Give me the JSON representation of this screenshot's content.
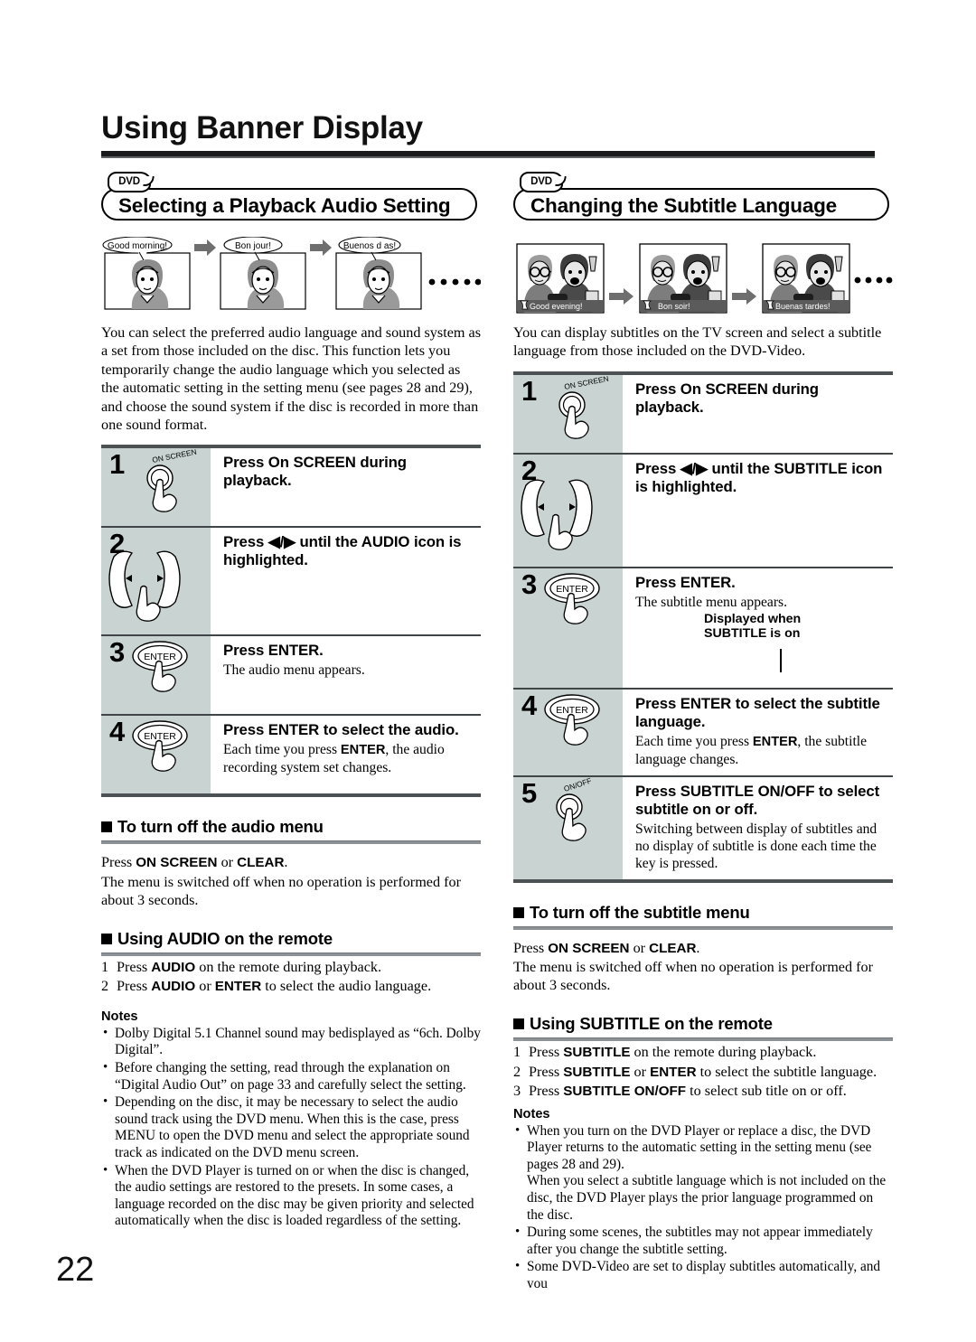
{
  "page": {
    "title": "Using Banner Display",
    "number": "22"
  },
  "left": {
    "badge": "DVD",
    "section_title": "Selecting a Playback Audio Setting",
    "illustration": {
      "bubbles": [
        "Good morning!",
        "Bon jour!",
        "Buenos d as!"
      ],
      "ellipsis": "• • • • •"
    },
    "intro": "You can select the preferred audio language and sound system as a set from those included on the disc. This function lets you temporarily change the audio language which you selected as the automatic setting in the setting menu (see pages 28 and 29), and choose the sound system if the disc is recorded in more than one sound format.",
    "steps": [
      {
        "num": "1",
        "icon": "on-screen-button",
        "icon_label": "ON SCREEN",
        "head": "Press On SCREEN during playback.",
        "sub": ""
      },
      {
        "num": "2",
        "icon": "left-right-arrow-keys",
        "icon_label": "",
        "head": "Press ◀/▶ until the AUDIO icon is highlighted.",
        "sub": ""
      },
      {
        "num": "3",
        "icon": "enter-button",
        "icon_label": "ENTER",
        "head": "Press ENTER.",
        "sub": "The audio menu appears."
      },
      {
        "num": "4",
        "icon": "enter-button",
        "icon_label": "ENTER",
        "head": "Press ENTER to select the audio.",
        "sub_parts": [
          "Each time you press ",
          "ENTER",
          ", the audio recording system set changes."
        ]
      }
    ],
    "subsections": [
      {
        "head": "To turn off the audio menu",
        "body_parts": [
          "Press ",
          "ON SCREEN",
          " or ",
          "CLEAR",
          "."
        ],
        "body_rest": "The menu is switched off when no operation is performed for about 3 seconds."
      },
      {
        "head": "Using AUDIO on the remote",
        "items": [
          {
            "n": "1",
            "parts": [
              "Press ",
              "AUDIO",
              " on the remote during playback."
            ]
          },
          {
            "n": "2",
            "parts": [
              "Press ",
              "AUDIO",
              " or ",
              "ENTER",
              " to select the audio language."
            ]
          }
        ]
      }
    ],
    "notes": {
      "title": "Notes",
      "items": [
        "Dolby Digital 5.1 Channel sound may bedisplayed as “6ch. Dolby Digital”.",
        "Before changing the setting, read through the explanation on “Digital Audio Out” on page 33 and carefully select the setting.",
        "Depending on the disc, it may be necessary to select the audio sound track using the DVD menu. When this is the case, press MENU to open the DVD menu and select the appropriate sound track as indicated on the DVD menu screen.",
        "When the DVD Player is turned on or when the disc is changed, the audio settings are restored to the presets. In some cases, a language recorded on the disc may be given priority and selected automatically when the disc is loaded regardless of the setting."
      ]
    }
  },
  "right": {
    "badge": "DVD",
    "section_title": "Changing the Subtitle Language",
    "illustration": {
      "captions": [
        "Good evening!",
        "Bon soir!",
        "Buenas tardes!"
      ],
      "ellipsis": "• • • • •"
    },
    "intro": "You can display subtitles on the TV screen and select a subtitle language from those included on the DVD-Video.",
    "steps": [
      {
        "num": "1",
        "icon": "on-screen-button",
        "icon_label": "ON SCREEN",
        "head": "Press On SCREEN during playback.",
        "sub": ""
      },
      {
        "num": "2",
        "icon": "left-right-arrow-keys",
        "icon_label": "",
        "head": "Press ◀/▶ until the SUBTITLE icon is highlighted.",
        "sub": ""
      },
      {
        "num": "3",
        "icon": "enter-button",
        "icon_label": "ENTER",
        "head": "Press ENTER.",
        "sub": "The subtitle menu appears.",
        "callout": "Displayed when\nSUBTITLE is on"
      },
      {
        "num": "4",
        "icon": "enter-button",
        "icon_label": "ENTER",
        "head": "Press ENTER to select the subtitle language.",
        "sub_parts": [
          "Each time you press ",
          "ENTER",
          ", the subtitle language changes."
        ]
      },
      {
        "num": "5",
        "icon": "on-off-button",
        "icon_label": "ON/OFF",
        "head": "Press SUBTITLE ON/OFF to select subtitle on or off.",
        "sub": "Switching between display of subtitles and no display of subtitle is done each time the key is pressed."
      }
    ],
    "subsections": [
      {
        "head": "To turn off the subtitle menu",
        "body_parts": [
          "Press ",
          "ON SCREEN",
          " or ",
          "CLEAR",
          "."
        ],
        "body_rest": "The menu is switched off when no operation is performed for about 3 seconds."
      },
      {
        "head": "Using SUBTITLE on the remote",
        "items": [
          {
            "n": "1",
            "parts": [
              "Press ",
              "SUBTITLE",
              " on the remote during playback."
            ]
          },
          {
            "n": "2",
            "parts": [
              "Press ",
              "SUBTITLE",
              " or ",
              "ENTER",
              " to select the subtitle language."
            ]
          },
          {
            "n": "3",
            "parts": [
              "Press ",
              "SUBTITLE ON/OFF",
              " to select sub title on or off."
            ]
          }
        ]
      }
    ],
    "notes": {
      "title": "Notes",
      "items": [
        "When you turn on the DVD Player or replace a disc, the DVD Player returns to the automatic setting in the setting menu (see pages 28 and 29).",
        "During some scenes, the subtitles may not appear immediately after you change the subtitle setting.",
        "Some DVD-Video are set to display subtitles automatically, and you"
      ],
      "item1_continued": "When you select a subtitle language which is not included on the disc, the DVD Player plays the prior language programmed on the disc."
    }
  },
  "colors": {
    "step_icon_bg": "#c9d4d2",
    "rule_dark": "#4c5254",
    "rule_gray": "#8c9295",
    "text": "#000000"
  }
}
